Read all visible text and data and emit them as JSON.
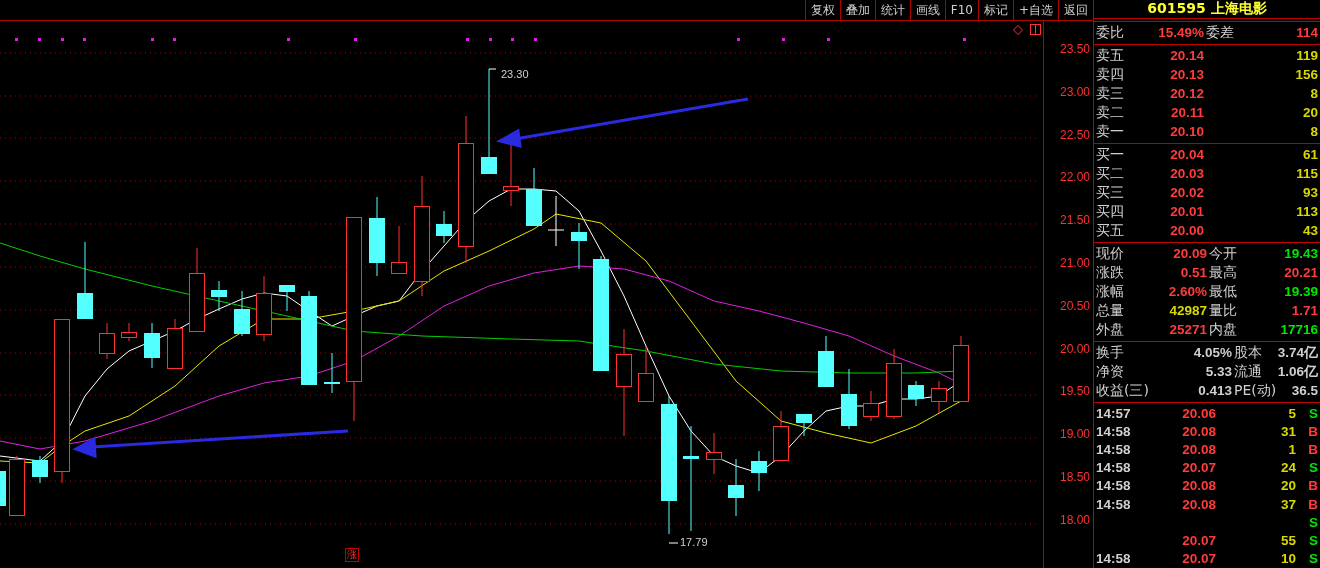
{
  "toolbar": [
    {
      "label": "复权"
    },
    {
      "label": "叠加"
    },
    {
      "label": "统计"
    },
    {
      "label": "画线"
    },
    {
      "label": "F10"
    },
    {
      "label": "标记"
    },
    {
      "label": "+自选"
    },
    {
      "label": "返回"
    }
  ],
  "stock": {
    "code": "601595",
    "name": "上海电影"
  },
  "chart": {
    "high_label": "23.30",
    "low_label": "17.79",
    "marker": "涨",
    "price_axis": [
      "23.50",
      "23.00",
      "22.50",
      "22.00",
      "21.50",
      "21.00",
      "20.50",
      "20.00",
      "19.50",
      "19.00",
      "18.50",
      "18.00"
    ]
  },
  "order_ratio": {
    "label": "委比",
    "value": "15.49%",
    "diff_label": "委差",
    "diff": "114"
  },
  "asks": [
    {
      "label": "卖五",
      "price": "20.14",
      "volume": "119"
    },
    {
      "label": "卖四",
      "price": "20.13",
      "volume": "156"
    },
    {
      "label": "卖三",
      "price": "20.12",
      "volume": "8"
    },
    {
      "label": "卖二",
      "price": "20.11",
      "volume": "20"
    },
    {
      "label": "卖一",
      "price": "20.10",
      "volume": "8"
    }
  ],
  "bids": [
    {
      "label": "买一",
      "price": "20.04",
      "volume": "61"
    },
    {
      "label": "买二",
      "price": "20.03",
      "volume": "115"
    },
    {
      "label": "买三",
      "price": "20.02",
      "volume": "93"
    },
    {
      "label": "买四",
      "price": "20.01",
      "volume": "113"
    },
    {
      "label": "买五",
      "price": "20.00",
      "volume": "43"
    }
  ],
  "quote": [
    {
      "label": "现价",
      "value": "20.09",
      "color": "#ff3b3b"
    },
    {
      "label": "今开",
      "value": "19.43",
      "color": "#00e600"
    },
    {
      "label": "涨跌",
      "value": "0.51",
      "color": "#ff3b3b"
    },
    {
      "label": "最高",
      "value": "20.21",
      "color": "#ff3b3b"
    },
    {
      "label": "涨幅",
      "value": "2.60%",
      "color": "#ff3b3b"
    },
    {
      "label": "最低",
      "value": "19.39",
      "color": "#00e600"
    },
    {
      "label": "总量",
      "value": "42987",
      "color": "#d8d800"
    },
    {
      "label": "量比",
      "value": "1.71",
      "color": "#ff3b3b"
    },
    {
      "label": "外盘",
      "value": "25271",
      "color": "#ff3b3b"
    },
    {
      "label": "内盘",
      "value": "17716",
      "color": "#00e600"
    }
  ],
  "fundamentals": [
    {
      "label": "换手",
      "value": "4.05%",
      "label2": "股本",
      "value2": "3.74亿"
    },
    {
      "label": "净资",
      "value": "5.33",
      "label2": "流通",
      "value2": "1.06亿"
    },
    {
      "label": "收益(三)",
      "value": "0.413",
      "label2": "PE(动)",
      "value2": "36.5"
    }
  ],
  "trades": [
    {
      "time": "14:57",
      "price": "20.06",
      "volume": "5",
      "side": "S",
      "kind": "sell"
    },
    {
      "time": "14:58",
      "price": "20.08",
      "volume": "31",
      "side": "B",
      "kind": "buy"
    },
    {
      "time": "14:58",
      "price": "20.08",
      "volume": "1",
      "side": "B",
      "kind": "buy"
    },
    {
      "time": "14:58",
      "price": "20.07",
      "volume": "24",
      "side": "S",
      "kind": "sell"
    },
    {
      "time": "14:58",
      "price": "20.08",
      "volume": "20",
      "side": "B",
      "kind": "buy"
    },
    {
      "time": "14:58",
      "price": "20.08",
      "volume": "37",
      "side": "B",
      "kind": "buy"
    },
    {
      "side": "S",
      "kind": "sell"
    },
    {
      "price": "20.07",
      "volume": "55",
      "side": "S",
      "kind": "sell"
    },
    {
      "time": "14:58",
      "price": "20.07",
      "volume": "10",
      "side": "S",
      "kind": "sell"
    }
  ]
}
